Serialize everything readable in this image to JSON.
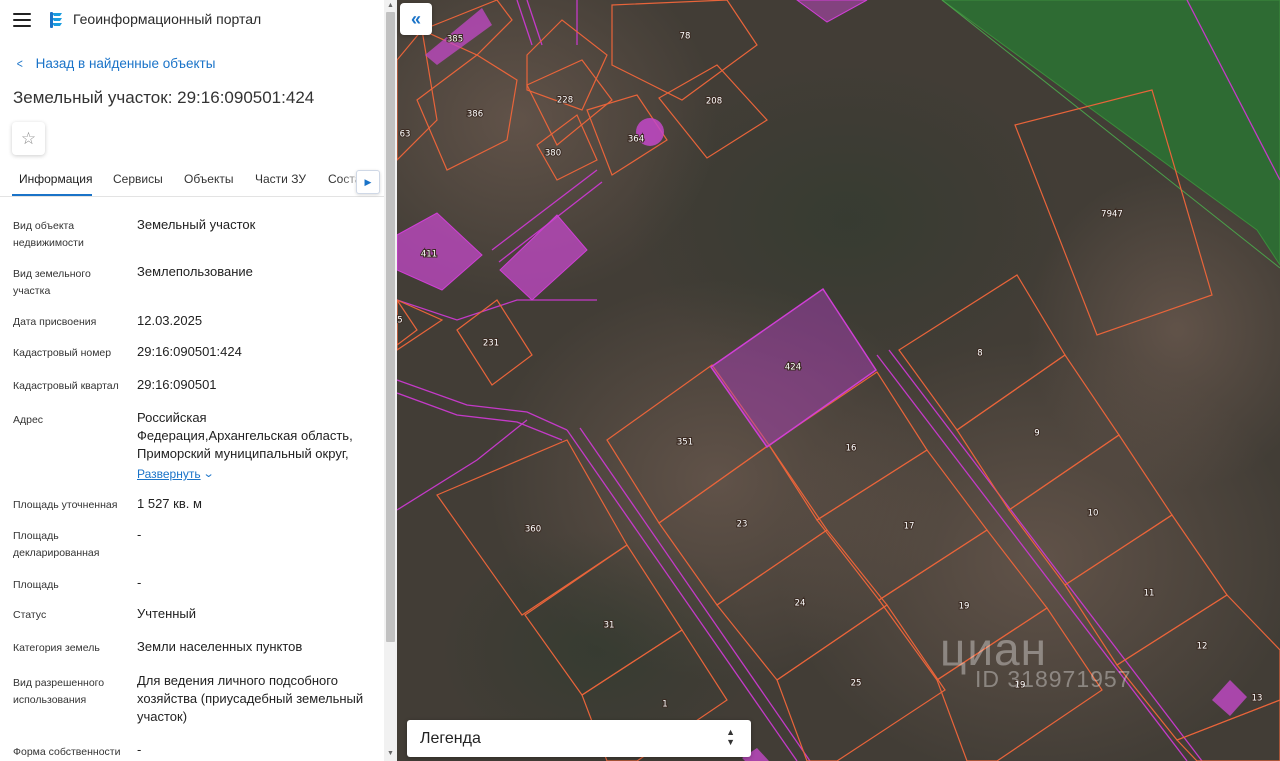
{
  "header": {
    "title": "Геоинформационный портал",
    "menu_icon": "hamburger-menu-icon",
    "logo_icon": "portal-logo-icon"
  },
  "back_link": {
    "label": "Назад в найденные объекты"
  },
  "page_title": "Земельный участок: 29:16:090501:424",
  "favorite_icon": "star-outline-icon",
  "tabs": [
    {
      "label": "Информация",
      "active": true
    },
    {
      "label": "Сервисы"
    },
    {
      "label": "Объекты"
    },
    {
      "label": "Части ЗУ"
    },
    {
      "label": "Соста"
    }
  ],
  "properties": {
    "object_type": {
      "label": "Вид объекта недвижимости",
      "value": "Земельный участок"
    },
    "land_type": {
      "label": "Вид земельного участка",
      "value": "Землепользование"
    },
    "assign_date": {
      "label": "Дата присвоения",
      "value": "12.03.2025"
    },
    "cadastral_number": {
      "label": "Кадастровый номер",
      "value": "29:16:090501:424"
    },
    "cadastral_quarter": {
      "label": "Кадастровый квартал",
      "value": "29:16:090501"
    },
    "address": {
      "label": "Адрес",
      "value": "Российская Федерация,Архангельская область, Приморский муниципальный округ,",
      "expand_label": "Развернуть"
    },
    "area_specified": {
      "label": "Площадь уточненная",
      "value": "1 527 кв. м"
    },
    "area_declared": {
      "label": "Площадь декларированная",
      "value": "-"
    },
    "area": {
      "label": "Площадь",
      "value": "-"
    },
    "status": {
      "label": "Статус",
      "value": "Учтенный"
    },
    "land_category": {
      "label": "Категория земель",
      "value": "Земли населенных пунктов"
    },
    "permitted_use": {
      "label": "Вид разрешенного использования",
      "value": "Для ведения личного подсобного хозяйства (приусадебный земельный участок)"
    },
    "ownership": {
      "label": "Форма собственности",
      "value": "-"
    }
  },
  "map": {
    "plots": [
      "385",
      "78",
      "228",
      "208",
      "386",
      "364",
      "380",
      "63",
      "411",
      "231",
      "7947",
      "424",
      "8",
      "351",
      "16",
      "9",
      "360",
      "23",
      "17",
      "10",
      "24",
      "19",
      "11",
      "31",
      "25",
      "19",
      "12",
      "1",
      "13",
      "5"
    ],
    "selected_plot": "424",
    "colors": {
      "plot_border": "#e8643a",
      "selected_border": "#d03fd6",
      "selected_fill": "#b23fc2",
      "forest": "#2e6b33"
    },
    "collapse_icon": "double-chevron-left-icon",
    "legend": {
      "label": "Легенда",
      "icon": "chevron-updown-icon"
    },
    "watermark": {
      "brand": "циан",
      "id": "ID 318971957"
    }
  }
}
